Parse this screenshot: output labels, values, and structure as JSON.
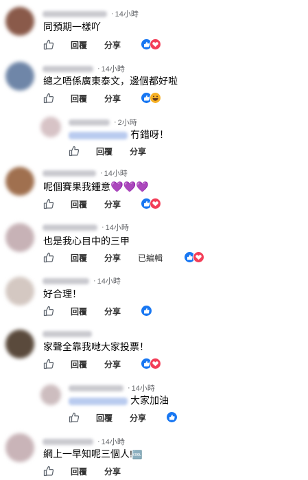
{
  "labels": {
    "reply": "回覆",
    "share": "分享"
  },
  "comments": [
    {
      "time": "14小時",
      "text": "同預期一樣吖",
      "reactions": [
        "like",
        "love"
      ]
    },
    {
      "time": "14小時",
      "text": "總之唔係廣東泰文，邊個都好啦",
      "reactions": [
        "like",
        "haha"
      ]
    },
    {
      "time": "2小時",
      "text": "冇錯呀！",
      "reactions": []
    },
    {
      "time": "14小時",
      "text": "呢個賽果我鍾意",
      "emoji": "💜💜💜",
      "reactions": [
        "like",
        "love"
      ]
    },
    {
      "time": "14小時",
      "text": "也是我心目中的三甲",
      "edited": "已編輯",
      "reactions": [
        "like",
        "love"
      ]
    },
    {
      "time": "14小時",
      "text": "好合理！",
      "reactions": [
        "like"
      ]
    },
    {
      "time": "14小時",
      "text": "家聲全靠我哋大家投票！",
      "reactions": [
        "like",
        "love"
      ]
    },
    {
      "time": "14小時",
      "text": "大家加油",
      "reactions": [
        "like"
      ]
    },
    {
      "time": "14小時",
      "text": "網上一早知呢三個人!",
      "emoji_badge": "🆒",
      "reactions": []
    }
  ],
  "colors": {
    "like": "#1877f2",
    "love": "#f33e58",
    "haha": "#f7b125",
    "meta": "#65676b"
  }
}
